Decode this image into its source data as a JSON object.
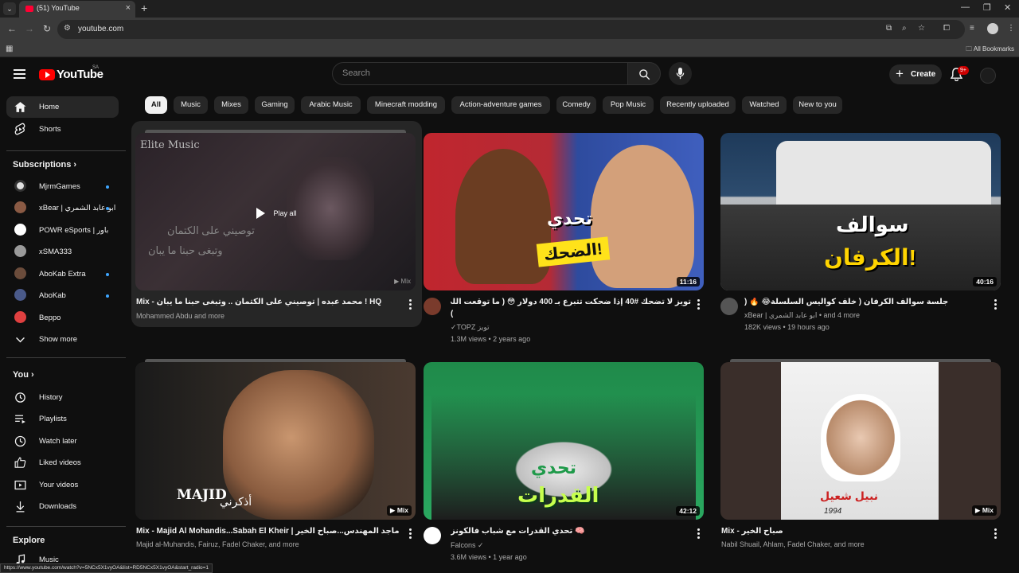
{
  "browser": {
    "tab_title": "(51) YouTube",
    "url": "youtube.com",
    "bookmarks_label": "All Bookmarks",
    "status_url": "https://www.youtube.com/watch?v=5NCx5X1vyOA&list=RD5NCx5X1vyOA&start_radio=1"
  },
  "header": {
    "logo_text": "YouTube",
    "country_code": "SA",
    "search_placeholder": "Search",
    "create_label": "Create",
    "notifications_badge": "9+"
  },
  "sidebar": {
    "main": [
      {
        "label": "Home",
        "icon": "home-icon"
      },
      {
        "label": "Shorts",
        "icon": "shorts-icon"
      }
    ],
    "subscriptions_title": "Subscriptions",
    "subscriptions": [
      {
        "label": "MjrmGames",
        "dot": true
      },
      {
        "label": "xBear | ابو عابد الشمري",
        "dot": true
      },
      {
        "label": "POWR eSports | باور",
        "dot": false
      },
      {
        "label": "xSMA333",
        "dot": false
      },
      {
        "label": "AboKab Extra",
        "dot": true
      },
      {
        "label": "AboKab",
        "dot": true
      },
      {
        "label": "Beppo",
        "dot": false
      }
    ],
    "show_more": "Show more",
    "you_title": "You",
    "you_items": [
      {
        "label": "History"
      },
      {
        "label": "Playlists"
      },
      {
        "label": "Watch later"
      },
      {
        "label": "Liked videos"
      },
      {
        "label": "Your videos"
      },
      {
        "label": "Downloads"
      }
    ],
    "explore_title": "Explore",
    "explore_items": [
      {
        "label": "Music"
      }
    ]
  },
  "chips": [
    "All",
    "Music",
    "Mixes",
    "Gaming",
    "Arabic Music",
    "Minecraft modding",
    "Action-adventure games",
    "Comedy",
    "Pop Music",
    "Recently uploaded",
    "Watched",
    "New to you"
  ],
  "videos": [
    {
      "title": "Mix - محمد عبده | توصيني على الكتمان .. وتبغى حبنا ما يبان ! HQ",
      "channel": "Mohammed Abdu and more",
      "stats": "",
      "badge": "Mix",
      "overlay_text": "Play all",
      "thumb_watermark": "Elite Music",
      "thumb_caption_1": "توصيني على الكتمان",
      "thumb_caption_2": "وتبغى حبنا ما يبان"
    },
    {
      "title": "تويز لا تضحك #40 إذا ضحكت تتبرع بـ 400 دولار 😳 ( ما توقعت اللي صار !",
      "title_line2": "(",
      "channel": "TOPZ تويز",
      "stats": "1.3M views • 2 years ago",
      "badge": "11:16",
      "thumb_text_1": "تحدي",
      "thumb_text_2": "الضحك!"
    },
    {
      "title": "جلسة سوالف الكرفان ( خلف كواليس السلسلة😂 🔥 (",
      "channel": "xBear | ابو عابد الشمري • and 4 more",
      "stats": "182K views • 19 hours ago",
      "badge": "40:16",
      "thumb_text_1": "سوالف",
      "thumb_text_2": "الكرفان!"
    },
    {
      "title": "Mix - Majid Al Mohandis...Sabah El Kheir | ماجد المهندس...صباح الخير",
      "channel": "Majid al-Muhandis, Fairuz, Fadel Chaker, and more",
      "stats": "",
      "badge": "Mix",
      "thumb_text_1": "MAJID",
      "thumb_text_2": "أذكرني"
    },
    {
      "title": "تحدي القدرات مع شباب فالكونز 🧠",
      "channel": "Falcons",
      "stats": "3.6M views • 1 year ago",
      "badge": "42:12",
      "thumb_text_1": "تحدي",
      "thumb_text_2": "القدرات"
    },
    {
      "title": "Mix - صباح الخير",
      "channel": "Nabil Shuail, Ahlam, Fadel Chaker, and more",
      "stats": "",
      "badge": "Mix",
      "thumb_text_1": "نبيل شعيل",
      "thumb_text_2": "1994"
    }
  ]
}
